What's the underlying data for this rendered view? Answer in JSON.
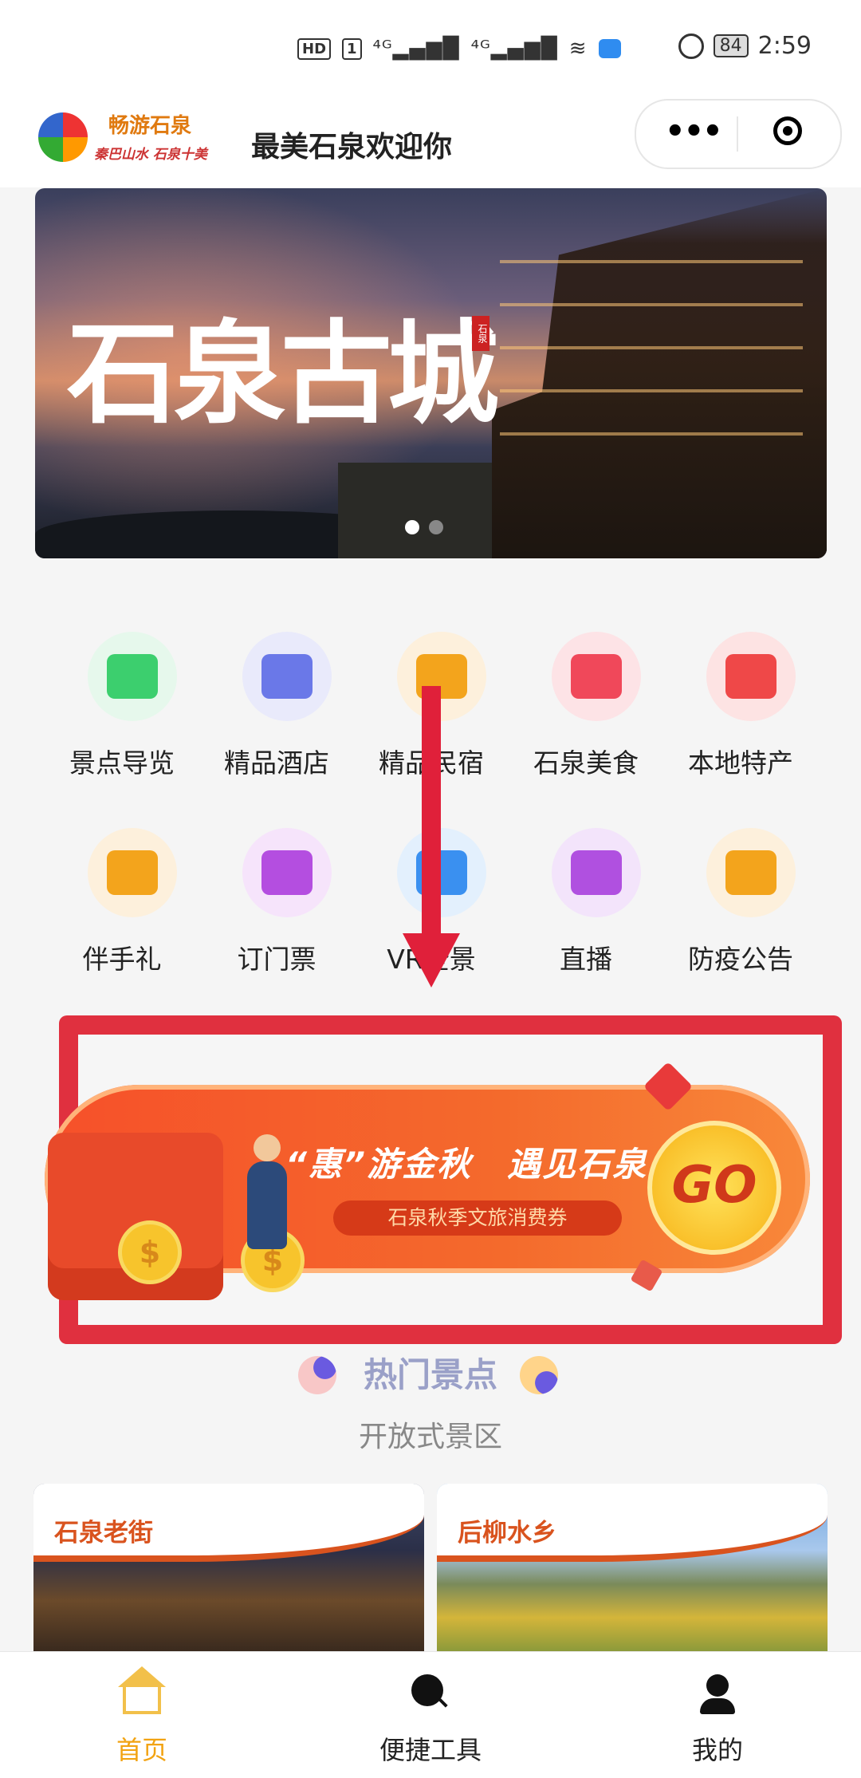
{
  "status_bar": {
    "hd_badge": "HD",
    "sim_badge": "1",
    "signal1": "⁴ᴳ▂▄▆█",
    "signal2": "⁴ᴳ▂▄▆█",
    "battery": "84",
    "time": "2:59"
  },
  "nav": {
    "logo_name": "畅游石泉",
    "logo_slogan": "秦巴山水 石泉十美",
    "title": "最美石泉欢迎你",
    "more_label": "•••"
  },
  "banner": {
    "title": "石泉古城",
    "seal": "石泉",
    "slide_count": 2,
    "active_slide": 1
  },
  "services": [
    {
      "label": "景点导览",
      "icon": "island-palm-icon",
      "bg": "#e6f8ec",
      "color": "#3ccf6e"
    },
    {
      "label": "精品酒店",
      "icon": "hotel-building-icon",
      "bg": "#e9eafb",
      "color": "#6a78e8"
    },
    {
      "label": "精品民宿",
      "icon": "homestay-building-icon",
      "bg": "#fdf0dc",
      "color": "#f3a41c"
    },
    {
      "label": "石泉美食",
      "icon": "food-cloche-icon",
      "bg": "#fde3e6",
      "color": "#f0485a"
    },
    {
      "label": "本地特产",
      "icon": "basket-icon",
      "bg": "#fde3e3",
      "color": "#ef4848"
    },
    {
      "label": "伴手礼",
      "icon": "gift-icon",
      "bg": "#fdf0dc",
      "color": "#f3a41c"
    },
    {
      "label": "订门票",
      "icon": "gate-ticket-icon",
      "bg": "#f6e4fb",
      "color": "#b44ee0"
    },
    {
      "label": "VR全景",
      "icon": "video-camera-icon",
      "bg": "#e3f0fd",
      "color": "#3a90f0"
    },
    {
      "label": "直播",
      "icon": "movie-camera-icon",
      "bg": "#f3e4fb",
      "color": "#b050e0"
    },
    {
      "label": "防疫公告",
      "icon": "megaphone-icon",
      "bg": "#fdf0dc",
      "color": "#f3a41c"
    }
  ],
  "promo": {
    "title": "“惠”游金秋　遇见石泉",
    "subtitle": "石泉秋季文旅消费券",
    "go_label": "GO",
    "coin_symbol": "$"
  },
  "hot_section": {
    "title": "热门景点",
    "subtitle": "开放式景区"
  },
  "cards": [
    {
      "label": "石泉老街"
    },
    {
      "label": "后柳水乡"
    }
  ],
  "tabbar": {
    "tabs": [
      {
        "label": "首页",
        "active": true
      },
      {
        "label": "便捷工具",
        "active": false
      },
      {
        "label": "我的",
        "active": false
      }
    ]
  },
  "colors": {
    "accent": "#f2a312",
    "highlight_frame": "#e0303f",
    "arrow": "#e0203a"
  }
}
